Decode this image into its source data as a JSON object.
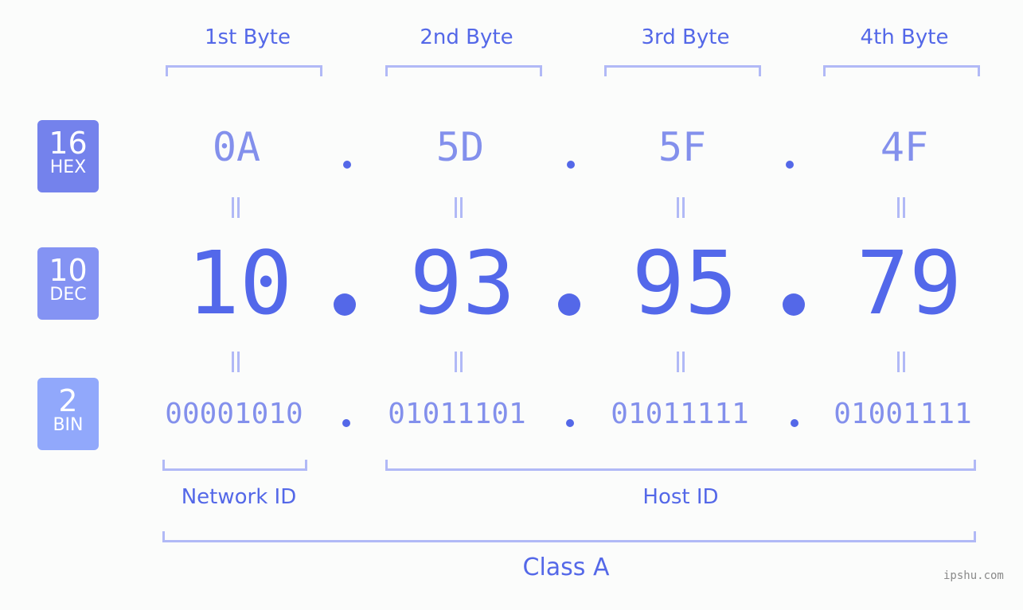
{
  "byte_headers": [
    "1st Byte",
    "2nd Byte",
    "3rd Byte",
    "4th Byte"
  ],
  "badges": [
    {
      "num": "16",
      "label": "HEX",
      "color": "#7482ec"
    },
    {
      "num": "10",
      "label": "DEC",
      "color": "#8493f3"
    },
    {
      "num": "2",
      "label": "BIN",
      "color": "#91a8fb"
    }
  ],
  "hex_values": [
    "0A",
    "5D",
    "5F",
    "4F"
  ],
  "dec_values": [
    "10",
    "93",
    "95",
    "79"
  ],
  "bin_values": [
    "00001010",
    "01011101",
    "01011111",
    "01001111"
  ],
  "network_id_label": "Network ID",
  "host_id_label": "Host ID",
  "class_label": "Class A",
  "watermark": "ipshu.com"
}
